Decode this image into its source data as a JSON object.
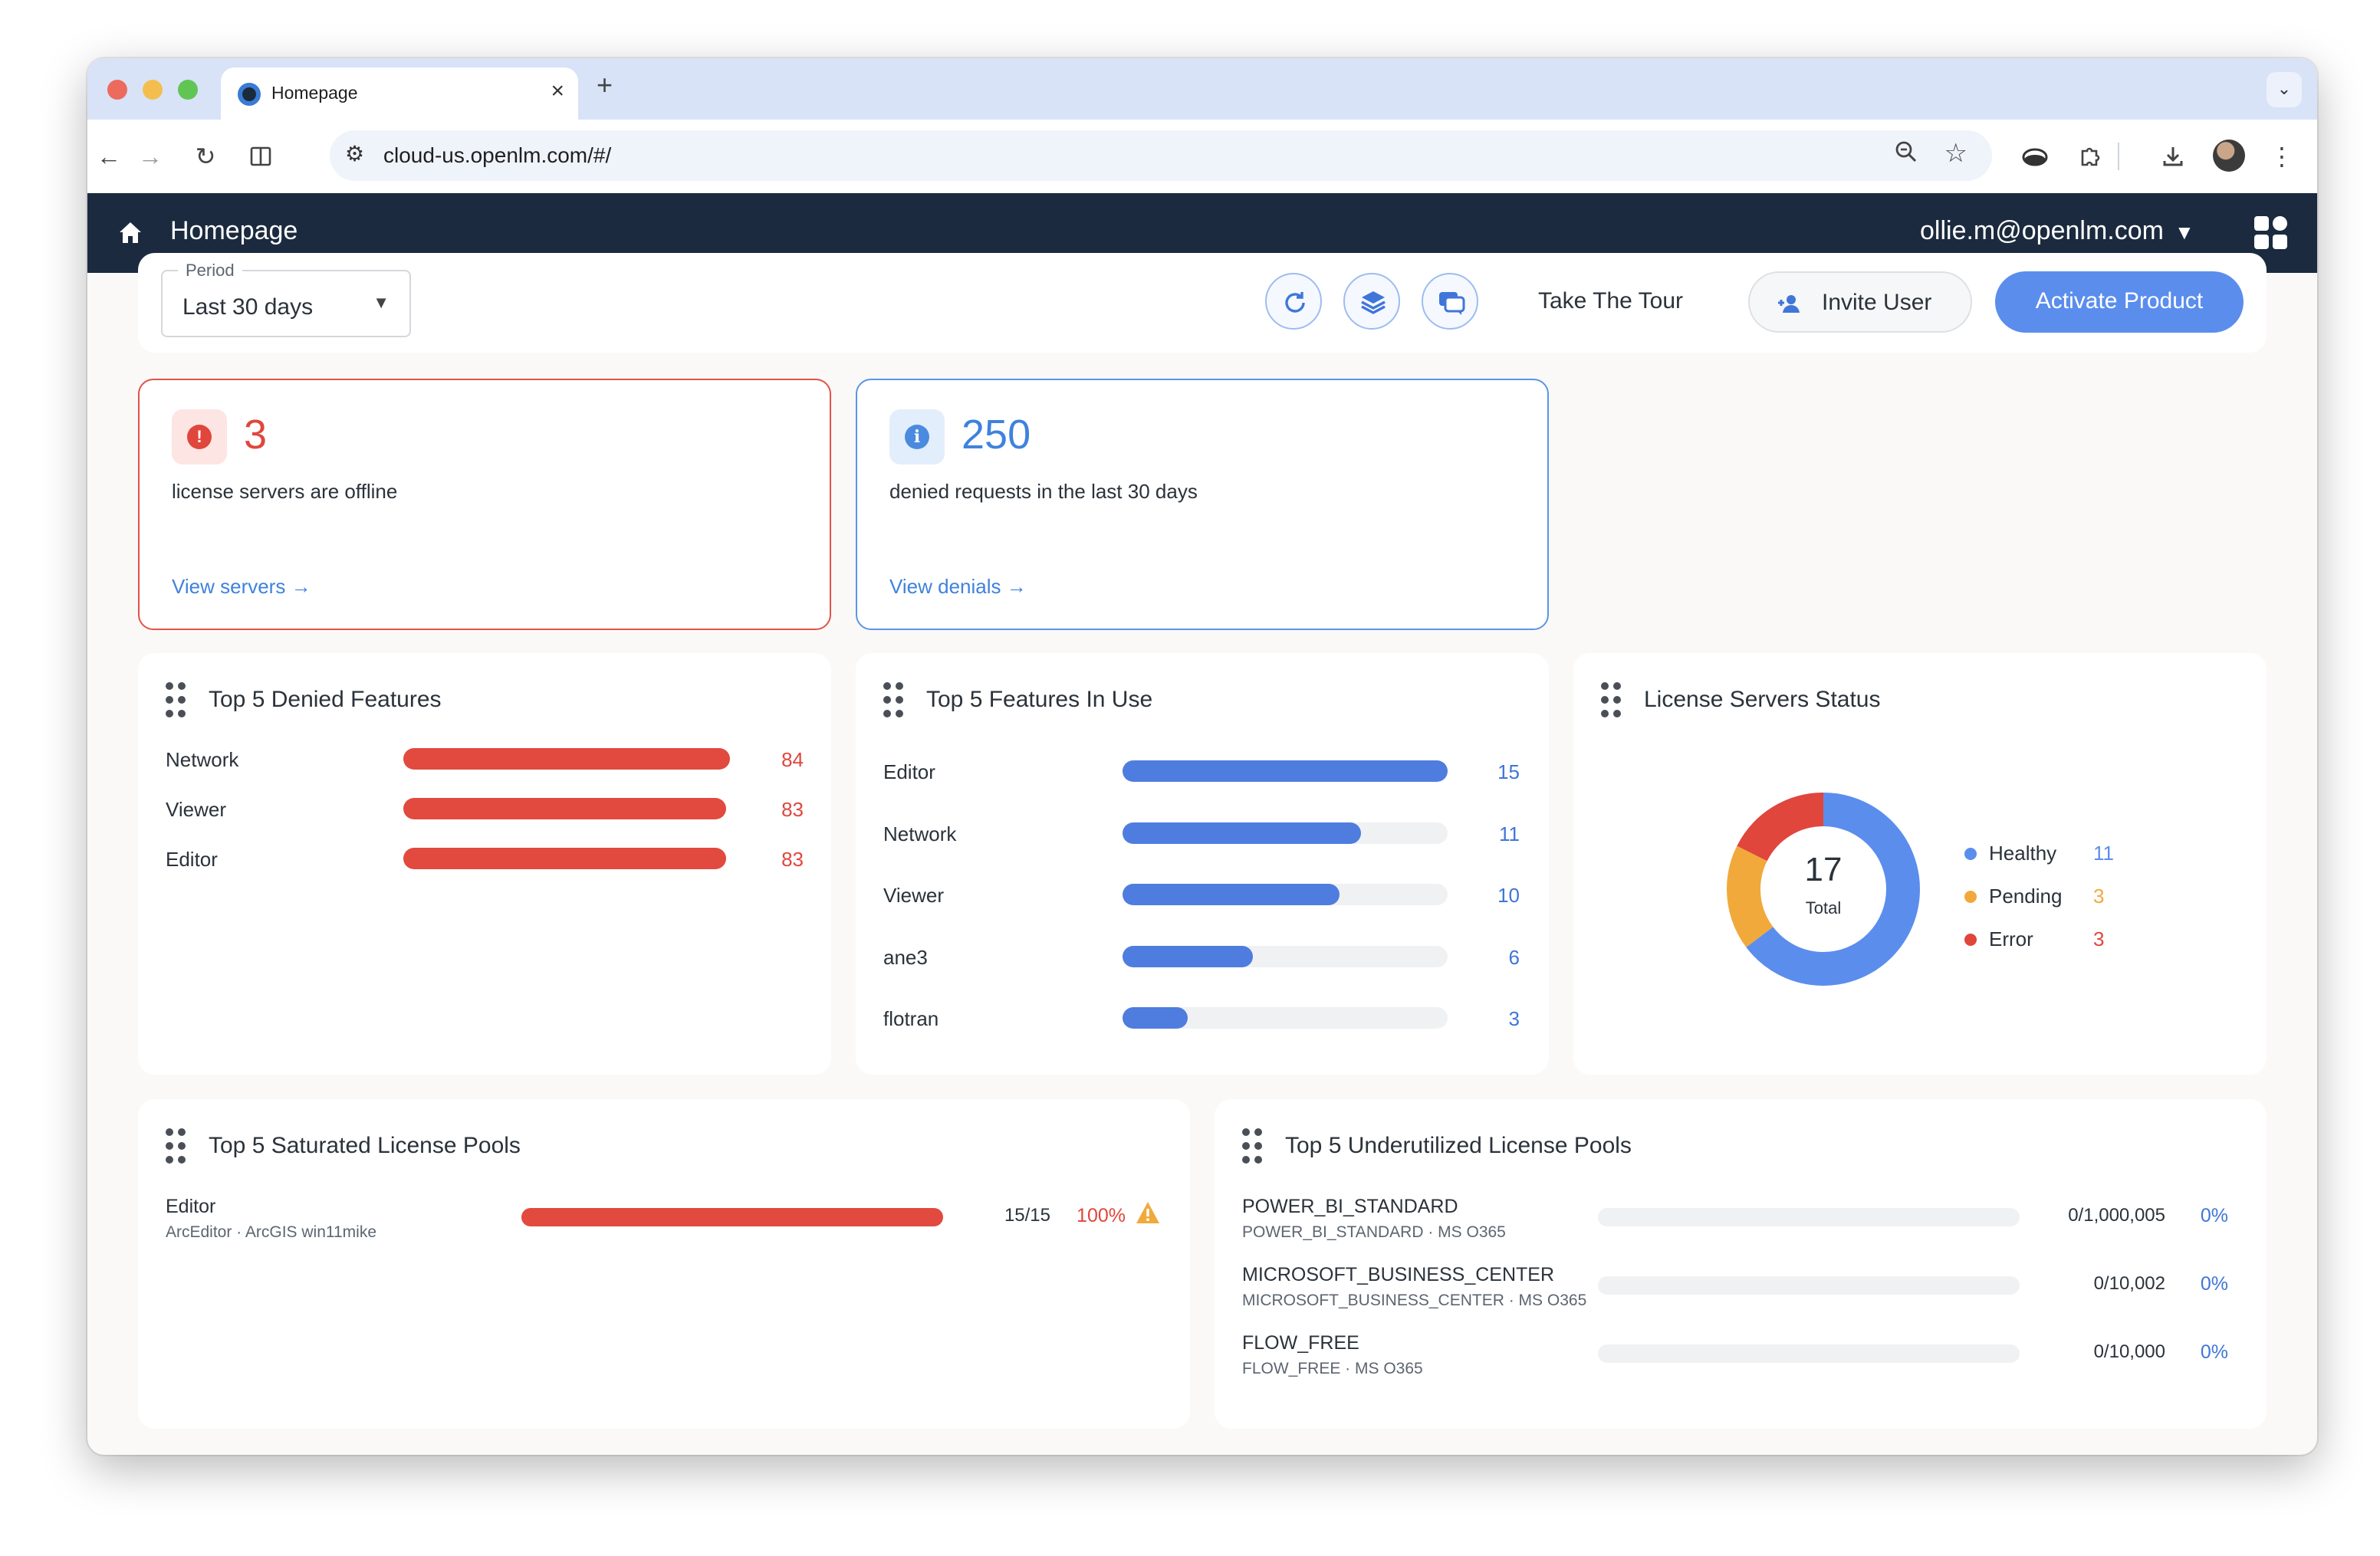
{
  "browser": {
    "tab_title": "Homepage",
    "url": "cloud-us.openlm.com/#/"
  },
  "app": {
    "title": "Homepage",
    "user": "ollie.m@openlm.com"
  },
  "filters": {
    "period_label": "Period",
    "period_value": "Last 30 days",
    "take_tour": "Take The Tour",
    "invite_user": "Invite User",
    "activate_product": "Activate Product"
  },
  "alerts": {
    "offline": {
      "count": "3",
      "text": "license servers are offline",
      "link": "View servers →"
    },
    "denials": {
      "count": "250",
      "text": "denied requests in the last 30 days",
      "link": "View denials →"
    }
  },
  "denied_features": {
    "title": "Top 5 Denied Features",
    "max": 84,
    "items": [
      {
        "label": "Network",
        "value": 84
      },
      {
        "label": "Viewer",
        "value": 83
      },
      {
        "label": "Editor",
        "value": 83
      }
    ]
  },
  "features_in_use": {
    "title": "Top 5 Features In Use",
    "max": 15,
    "items": [
      {
        "label": "Editor",
        "value": 15
      },
      {
        "label": "Network",
        "value": 11
      },
      {
        "label": "Viewer",
        "value": 10
      },
      {
        "label": "ane3",
        "value": 6
      },
      {
        "label": "flotran",
        "value": 3
      }
    ]
  },
  "server_status": {
    "title": "License Servers Status",
    "total": "17",
    "total_label": "Total",
    "items": [
      {
        "label": "Healthy",
        "value": 11,
        "color": "#5b8ded"
      },
      {
        "label": "Pending",
        "value": 3,
        "color": "#f2a93b"
      },
      {
        "label": "Error",
        "value": 3,
        "color": "#e0463c"
      }
    ]
  },
  "saturated_pools": {
    "title": "Top 5 Saturated License Pools",
    "items": [
      {
        "name": "Editor",
        "sub": "ArcEditor · ArcGIS win11mike",
        "count": "15/15",
        "pct": "100%",
        "fraction": 1.0
      }
    ]
  },
  "underutilized_pools": {
    "title": "Top 5 Underutilized License Pools",
    "items": [
      {
        "name": "POWER_BI_STANDARD",
        "sub": "POWER_BI_STANDARD · MS O365",
        "count": "0/1,000,005",
        "pct": "0%",
        "fraction": 0
      },
      {
        "name": "MICROSOFT_BUSINESS_CENTER",
        "sub": "MICROSOFT_BUSINESS_CENTER · MS O365",
        "count": "0/10,002",
        "pct": "0%",
        "fraction": 0
      },
      {
        "name": "FLOW_FREE",
        "sub": "FLOW_FREE · MS O365",
        "count": "0/10,000",
        "pct": "0%",
        "fraction": 0
      }
    ]
  }
}
